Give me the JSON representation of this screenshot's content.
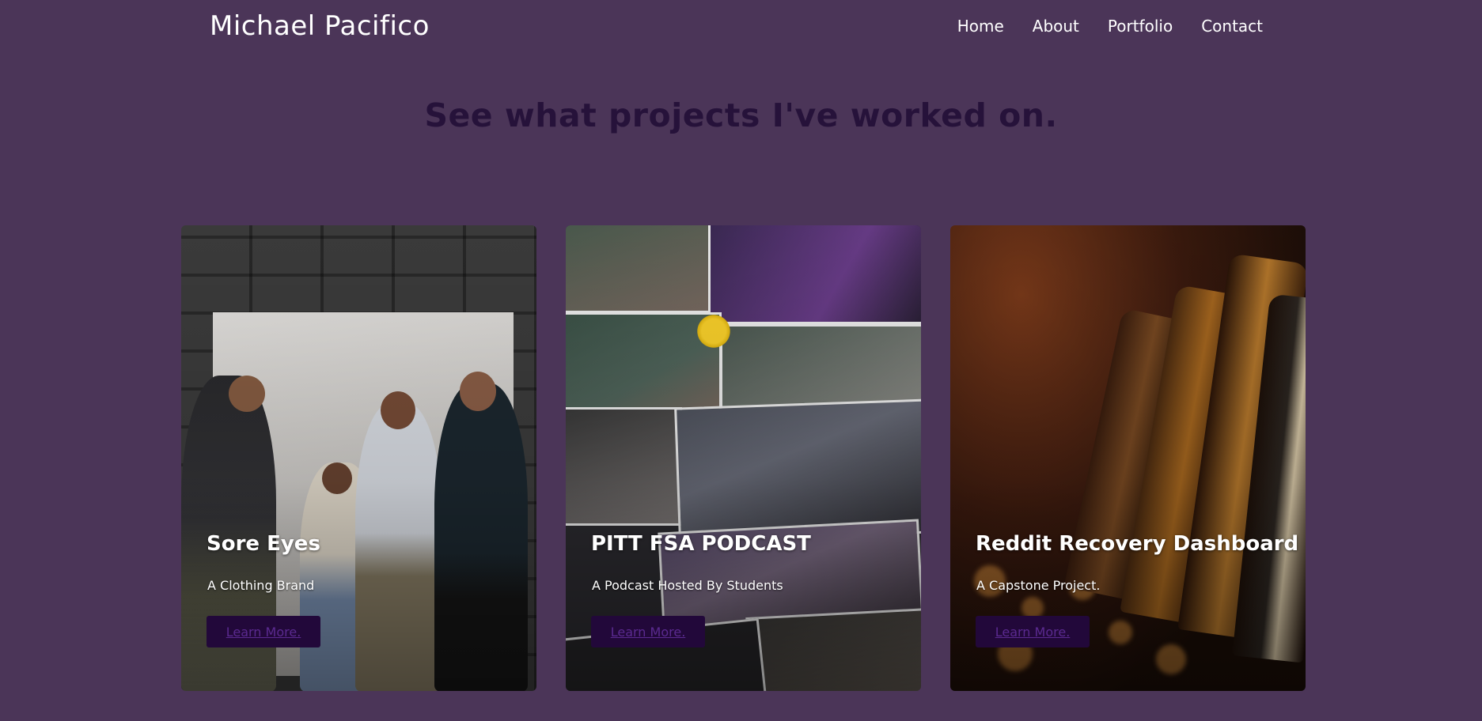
{
  "header": {
    "brand": "Michael Pacifico",
    "nav": [
      "Home",
      "About",
      "Portfolio",
      "Contact"
    ]
  },
  "headline": "See what projects I've worked on.",
  "projects": [
    {
      "title": "Sore Eyes",
      "subtitle": "A Clothing Brand",
      "button": "Learn More."
    },
    {
      "title": "PITT FSA PODCAST",
      "subtitle": "A Podcast Hosted By Students",
      "button": "Learn More."
    },
    {
      "title": "Reddit Recovery Dashboard",
      "subtitle": "A Capstone Project.",
      "button": "Learn More."
    }
  ],
  "colors": {
    "background": "#4b3558",
    "headline": "#26123a",
    "button_bg": "#22083a",
    "button_text": "#5b2a90"
  }
}
